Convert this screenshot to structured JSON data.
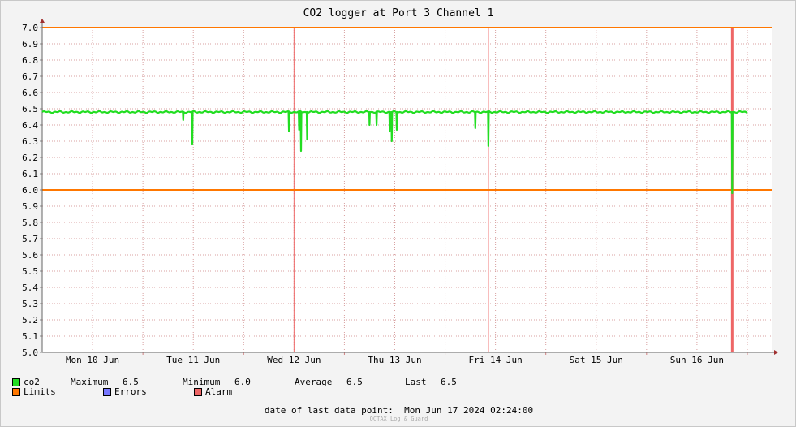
{
  "chart_data": {
    "type": "line",
    "title": "CO2 logger at Port 3 Channel 1",
    "ylim": [
      5.0,
      7.0
    ],
    "yticks": [
      "5.0",
      "5.1",
      "5.2",
      "5.3",
      "5.4",
      "5.5",
      "5.6",
      "5.7",
      "5.8",
      "5.9",
      "6.0",
      "6.1",
      "6.2",
      "6.3",
      "6.4",
      "6.5",
      "6.6",
      "6.7",
      "6.8",
      "6.9",
      "7.0"
    ],
    "xlim": [
      0,
      7.25
    ],
    "x_unit": "days from Mon 10 Jun 00:00",
    "xticks": [
      {
        "x": 0.5,
        "label": "Mon 10 Jun"
      },
      {
        "x": 1.5,
        "label": "Tue 11 Jun"
      },
      {
        "x": 2.5,
        "label": "Wed 12 Jun"
      },
      {
        "x": 3.5,
        "label": "Thu 13 Jun"
      },
      {
        "x": 4.5,
        "label": "Fri 14 Jun"
      },
      {
        "x": 5.5,
        "label": "Sat 15 Jun"
      },
      {
        "x": 6.5,
        "label": "Sun 16 Jun"
      }
    ],
    "limits": [
      6.0,
      7.0
    ],
    "alarm_x": [
      2.5,
      4.43,
      6.85
    ],
    "series": [
      {
        "name": "co2",
        "color": "#22dd22",
        "baseline": 6.48,
        "x_end": 7.0,
        "dips": [
          {
            "x": 1.4,
            "y": 6.43
          },
          {
            "x": 1.49,
            "y": 6.28
          },
          {
            "x": 2.45,
            "y": 6.36
          },
          {
            "x": 2.55,
            "y": 6.37
          },
          {
            "x": 2.57,
            "y": 6.24
          },
          {
            "x": 2.63,
            "y": 6.31
          },
          {
            "x": 3.25,
            "y": 6.4
          },
          {
            "x": 3.32,
            "y": 6.4
          },
          {
            "x": 3.45,
            "y": 6.36
          },
          {
            "x": 3.47,
            "y": 6.3
          },
          {
            "x": 3.52,
            "y": 6.37
          },
          {
            "x": 4.3,
            "y": 6.38
          },
          {
            "x": 4.43,
            "y": 6.27
          },
          {
            "x": 6.85,
            "y": 5.98
          }
        ]
      }
    ]
  },
  "legend": {
    "co2_label": "co2",
    "maximum": "Maximum",
    "maximum_value": "6.5",
    "minimum": "Minimum",
    "minimum_value": "6.0",
    "average": "Average",
    "average_value": "6.5",
    "last": "Last",
    "last_value": "6.5",
    "limits_label": "Limits",
    "errors_label": "Errors",
    "alarm_label": "Alarm",
    "colors": {
      "co2": "#22dd22",
      "limits": "#ff7700",
      "errors": "#7777ff",
      "alarm": "#ee6666"
    }
  },
  "footer": {
    "last_point_label": "date of last data point:",
    "last_point_value": "Mon Jun 17 2024 02:24:00",
    "credit": "OCTAX Log & Guard"
  }
}
